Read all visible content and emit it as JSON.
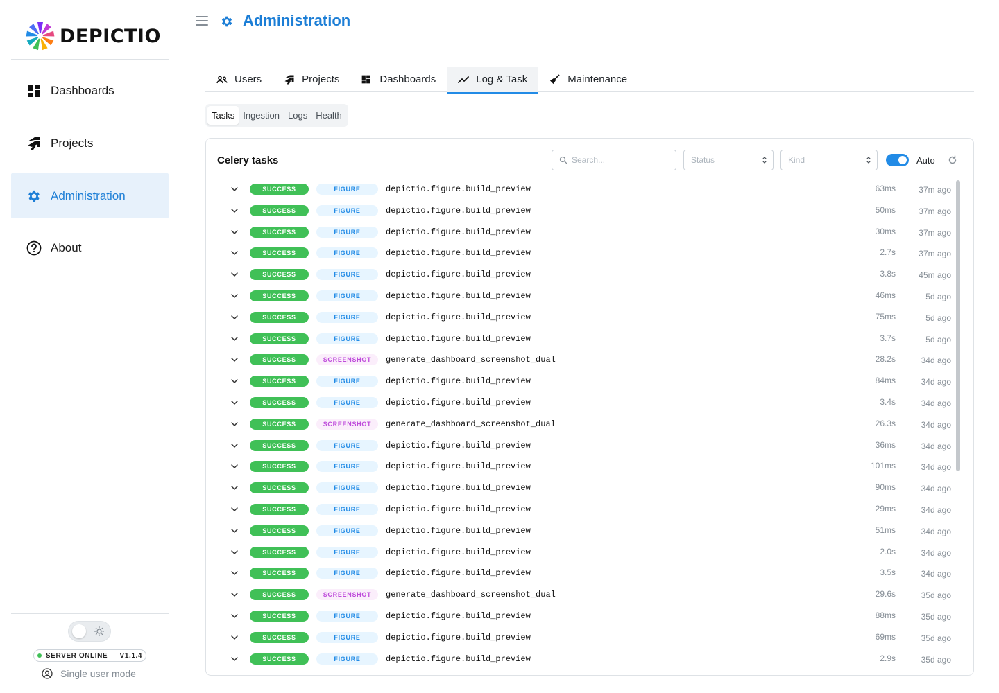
{
  "app": {
    "name": "DEPICTIO",
    "colors": {
      "accent": "#1c7ed6",
      "success": "#40c057",
      "figure_bg": "#e7f5ff",
      "figure_fg": "#228be6",
      "screenshot_bg": "#fbeefb",
      "screenshot_fg": "#be4bdb"
    }
  },
  "sidebar": {
    "items": [
      {
        "label": "Dashboards",
        "icon": "dashboard-grid-icon"
      },
      {
        "label": "Projects",
        "icon": "projects-icon"
      },
      {
        "label": "Administration",
        "icon": "gear-icon",
        "active": true
      },
      {
        "label": "About",
        "icon": "question-circle-icon"
      }
    ],
    "server_status": "SERVER ONLINE — V1.1.4",
    "user_mode": "Single user mode"
  },
  "header": {
    "title": "Administration"
  },
  "tabs": [
    {
      "label": "Users",
      "icon": "users-icon"
    },
    {
      "label": "Projects",
      "icon": "projects-icon"
    },
    {
      "label": "Dashboards",
      "icon": "dashboard-grid-icon"
    },
    {
      "label": "Log & Task",
      "icon": "trend-line-icon",
      "active": true
    },
    {
      "label": "Maintenance",
      "icon": "broom-icon"
    }
  ],
  "subtabs": [
    {
      "label": "Tasks",
      "active": true
    },
    {
      "label": "Ingestion"
    },
    {
      "label": "Logs"
    },
    {
      "label": "Health"
    }
  ],
  "tasks_card": {
    "title": "Celery tasks",
    "search_placeholder": "Search...",
    "status_placeholder": "Status",
    "kind_placeholder": "Kind",
    "auto_label": "Auto",
    "auto_enabled": true,
    "rows": [
      {
        "status": "SUCCESS",
        "kind": "FIGURE",
        "name": "depictio.figure.build_preview",
        "duration": "63ms",
        "ago": "37m ago"
      },
      {
        "status": "SUCCESS",
        "kind": "FIGURE",
        "name": "depictio.figure.build_preview",
        "duration": "50ms",
        "ago": "37m ago"
      },
      {
        "status": "SUCCESS",
        "kind": "FIGURE",
        "name": "depictio.figure.build_preview",
        "duration": "30ms",
        "ago": "37m ago"
      },
      {
        "status": "SUCCESS",
        "kind": "FIGURE",
        "name": "depictio.figure.build_preview",
        "duration": "2.7s",
        "ago": "37m ago"
      },
      {
        "status": "SUCCESS",
        "kind": "FIGURE",
        "name": "depictio.figure.build_preview",
        "duration": "3.8s",
        "ago": "45m ago"
      },
      {
        "status": "SUCCESS",
        "kind": "FIGURE",
        "name": "depictio.figure.build_preview",
        "duration": "46ms",
        "ago": "5d ago"
      },
      {
        "status": "SUCCESS",
        "kind": "FIGURE",
        "name": "depictio.figure.build_preview",
        "duration": "75ms",
        "ago": "5d ago"
      },
      {
        "status": "SUCCESS",
        "kind": "FIGURE",
        "name": "depictio.figure.build_preview",
        "duration": "3.7s",
        "ago": "5d ago"
      },
      {
        "status": "SUCCESS",
        "kind": "SCREENSHOT",
        "name": "generate_dashboard_screenshot_dual",
        "duration": "28.2s",
        "ago": "34d ago"
      },
      {
        "status": "SUCCESS",
        "kind": "FIGURE",
        "name": "depictio.figure.build_preview",
        "duration": "84ms",
        "ago": "34d ago"
      },
      {
        "status": "SUCCESS",
        "kind": "FIGURE",
        "name": "depictio.figure.build_preview",
        "duration": "3.4s",
        "ago": "34d ago"
      },
      {
        "status": "SUCCESS",
        "kind": "SCREENSHOT",
        "name": "generate_dashboard_screenshot_dual",
        "duration": "26.3s",
        "ago": "34d ago"
      },
      {
        "status": "SUCCESS",
        "kind": "FIGURE",
        "name": "depictio.figure.build_preview",
        "duration": "36ms",
        "ago": "34d ago"
      },
      {
        "status": "SUCCESS",
        "kind": "FIGURE",
        "name": "depictio.figure.build_preview",
        "duration": "101ms",
        "ago": "34d ago"
      },
      {
        "status": "SUCCESS",
        "kind": "FIGURE",
        "name": "depictio.figure.build_preview",
        "duration": "90ms",
        "ago": "34d ago"
      },
      {
        "status": "SUCCESS",
        "kind": "FIGURE",
        "name": "depictio.figure.build_preview",
        "duration": "29ms",
        "ago": "34d ago"
      },
      {
        "status": "SUCCESS",
        "kind": "FIGURE",
        "name": "depictio.figure.build_preview",
        "duration": "51ms",
        "ago": "34d ago"
      },
      {
        "status": "SUCCESS",
        "kind": "FIGURE",
        "name": "depictio.figure.build_preview",
        "duration": "2.0s",
        "ago": "34d ago"
      },
      {
        "status": "SUCCESS",
        "kind": "FIGURE",
        "name": "depictio.figure.build_preview",
        "duration": "3.5s",
        "ago": "34d ago"
      },
      {
        "status": "SUCCESS",
        "kind": "SCREENSHOT",
        "name": "generate_dashboard_screenshot_dual",
        "duration": "29.6s",
        "ago": "35d ago"
      },
      {
        "status": "SUCCESS",
        "kind": "FIGURE",
        "name": "depictio.figure.build_preview",
        "duration": "88ms",
        "ago": "35d ago"
      },
      {
        "status": "SUCCESS",
        "kind": "FIGURE",
        "name": "depictio.figure.build_preview",
        "duration": "69ms",
        "ago": "35d ago"
      },
      {
        "status": "SUCCESS",
        "kind": "FIGURE",
        "name": "depictio.figure.build_preview",
        "duration": "2.9s",
        "ago": "35d ago"
      }
    ]
  }
}
